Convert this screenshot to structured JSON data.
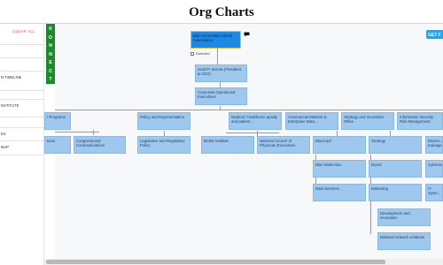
{
  "page": {
    "title": "Org Charts"
  },
  "sidebar": {
    "clear_all": "CLEAR ALL",
    "items": [
      {
        "label": ""
      },
      {
        "label": ""
      },
      {
        "label": "N TIMELINE"
      },
      {
        "label": ""
      },
      {
        "label": "NSTITUTE"
      },
      {
        "label": ""
      },
      {
        "label": "ES"
      },
      {
        "label": "MAP"
      }
    ]
  },
  "brand": {
    "letters": [
      "K",
      "O",
      "N",
      "N",
      "E",
      "C",
      "T"
    ]
  },
  "toolbar": {
    "get_button": "GET F"
  },
  "chart": {
    "root": "Blue Cross Blue Shield Association",
    "selected_label": "Selected",
    "level2": "Scott P. Serota (President & CEO)",
    "level3": "Corporate Operational Executives",
    "row1": [
      "/ Programs",
      "Policy and Representation",
      "Medical / healthcare quality and patient ...",
      "Commercial Markets & Enterprise Data ...",
      "Strategy and Innovation Office",
      "Information Security Risk Management"
    ],
    "row2": [
      "tions",
      "Congressional Communications",
      "Legislative and Regulatory Policy",
      "BCBS Institute",
      "National Council of Physician Executives",
      "BlueCard",
      "Strategy",
      "Electro... manage..."
    ],
    "col_bluecard": [
      "Blue Distinction",
      "Data Services"
    ],
    "col_strategy": [
      "Brand",
      "Marketing",
      "Development and innovation",
      "National network solutions"
    ],
    "col_right": [
      "Cyberse...",
      "IT Syste..."
    ]
  },
  "colors": {
    "accent": "#1e88e5",
    "node": "#9ec8ee",
    "brand_bar": "#1c8a2c",
    "clear_all": "#e05a5a",
    "button": "#29a3e4"
  },
  "icons": {
    "comment": "speech-bubble-icon",
    "checkbox": "checkbox-icon"
  }
}
